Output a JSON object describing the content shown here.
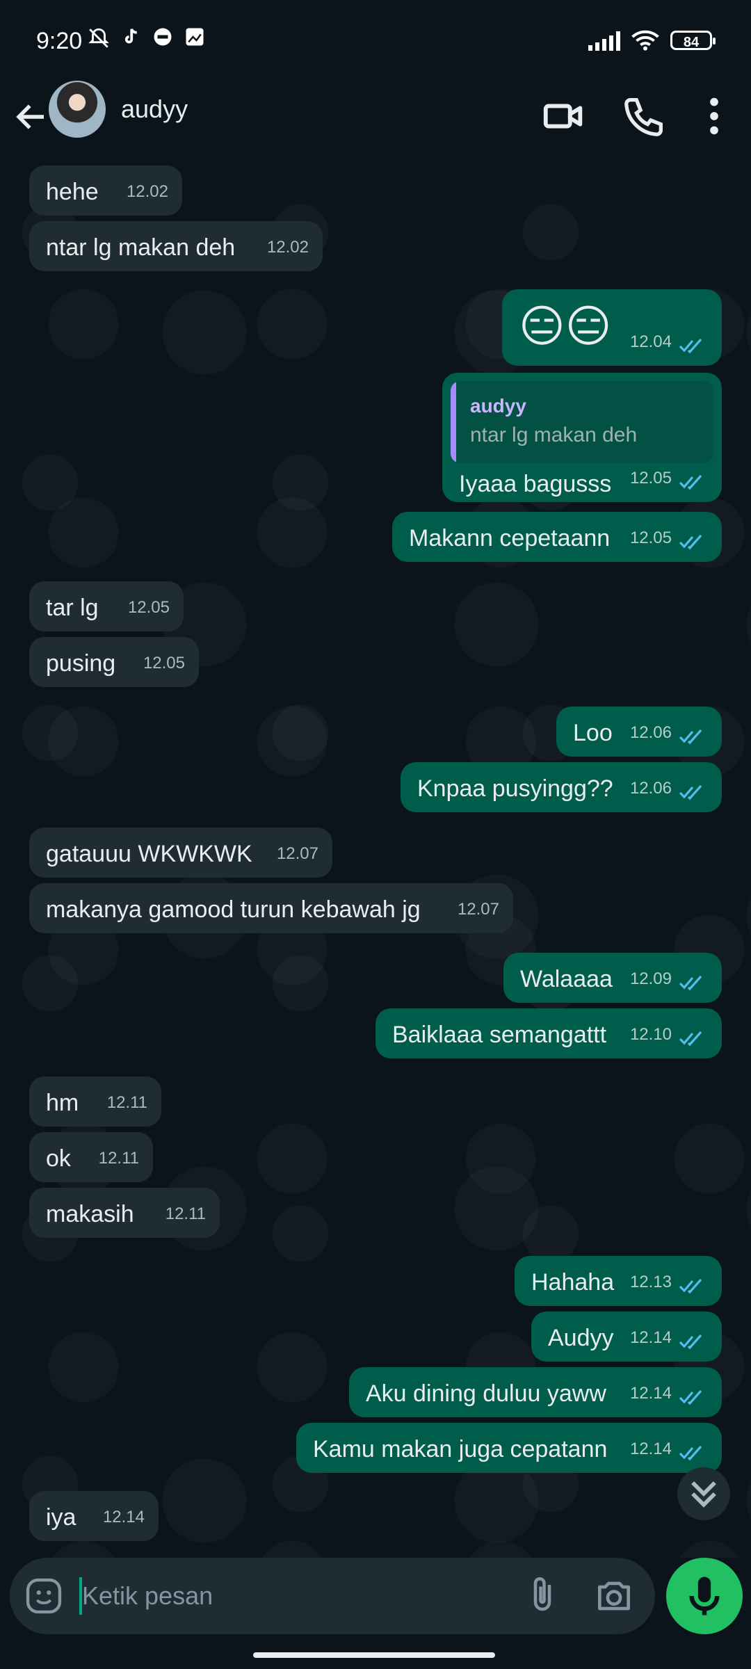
{
  "status": {
    "time": "9:20",
    "battery": "84"
  },
  "header": {
    "contact_name": "audyy"
  },
  "messages": [
    {
      "dir": "in",
      "text": "hehe",
      "time": "12.02"
    },
    {
      "dir": "in",
      "text": "ntar lg makan deh",
      "time": "12.02"
    },
    {
      "dir": "out",
      "text": "😑😑",
      "time": "12.04",
      "emoji": true
    },
    {
      "dir": "out",
      "text": "Iyaaa bagusss",
      "time": "12.05",
      "reply": {
        "name": "audyy",
        "text": "ntar lg makan deh"
      }
    },
    {
      "dir": "out",
      "text": "Makann cepetaann",
      "time": "12.05"
    },
    {
      "dir": "in",
      "text": "tar lg",
      "time": "12.05"
    },
    {
      "dir": "in",
      "text": "pusing",
      "time": "12.05"
    },
    {
      "dir": "out",
      "text": "Loo",
      "time": "12.06"
    },
    {
      "dir": "out",
      "text": "Knpaa pusyingg??",
      "time": "12.06"
    },
    {
      "dir": "in",
      "text": "gatauuu WKWKWK",
      "time": "12.07"
    },
    {
      "dir": "in",
      "text": "makanya gamood turun kebawah jg",
      "time": "12.07"
    },
    {
      "dir": "out",
      "text": "Walaaaa",
      "time": "12.09"
    },
    {
      "dir": "out",
      "text": "Baiklaaa semangattt",
      "time": "12.10"
    },
    {
      "dir": "in",
      "text": "hm",
      "time": "12.11"
    },
    {
      "dir": "in",
      "text": "ok",
      "time": "12.11"
    },
    {
      "dir": "in",
      "text": "makasih",
      "time": "12.11"
    },
    {
      "dir": "out",
      "text": "Hahaha",
      "time": "12.13"
    },
    {
      "dir": "out",
      "text": "Audyy",
      "time": "12.14"
    },
    {
      "dir": "out",
      "text": "Aku dining duluu yaww",
      "time": "12.14"
    },
    {
      "dir": "out",
      "text": "Kamu makan juga cepatann",
      "time": "12.14"
    },
    {
      "dir": "in",
      "text": "iya",
      "time": "12.14"
    }
  ],
  "composer": {
    "placeholder": "Ketik pesan"
  },
  "colors": {
    "incoming": "#202c33",
    "outgoing": "#005c4b",
    "accent": "#21c063",
    "read_ticks": "#53bdeb"
  }
}
